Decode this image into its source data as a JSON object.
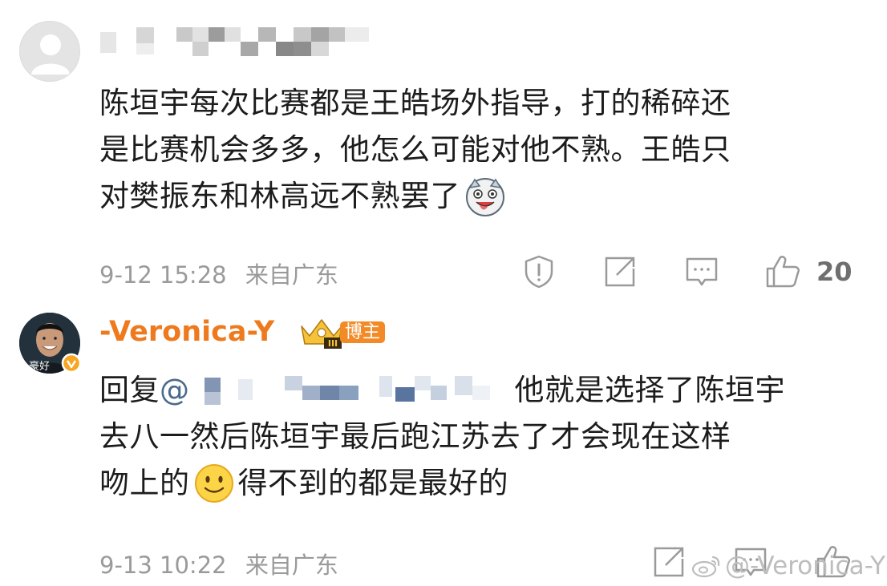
{
  "comments": [
    {
      "text_lines": [
        "陈垣宇每次比赛都是王皓场外指导，打的稀碎还",
        "是比赛机会多多，他怎么可能对他不熟。王皓只",
        "对樊振东和林高远不熟罢了"
      ],
      "emoji": "doge-emoji",
      "date": "9-12 15:28",
      "source": "来自广东",
      "like_count": "20",
      "actions": [
        "report-icon",
        "share-icon",
        "comment-icon",
        "like-icon"
      ]
    },
    {
      "username": "-Veronica-Y",
      "badge": "博主",
      "avatar_caption": "豪好",
      "reply_prefix": "回复",
      "mention_at": "@",
      "text_line1_tail": "他就是选择了陈垣宇",
      "text_lines": [
        "去八一然后陈垣宇最后跑江苏去了才会现在这样",
        "吻上的"
      ],
      "text_after_emoji": "得不到的都是最好的",
      "emoji": "smile-emoji",
      "date": "9-13 10:22",
      "source": "来自广东",
      "actions": [
        "share-icon",
        "comment-icon",
        "like-icon"
      ]
    }
  ],
  "watermark": "@-Veronica-Y",
  "colors": {
    "accent": "#ee7a1d",
    "meta": "#9a9a9a",
    "text": "#1c1c1c"
  }
}
